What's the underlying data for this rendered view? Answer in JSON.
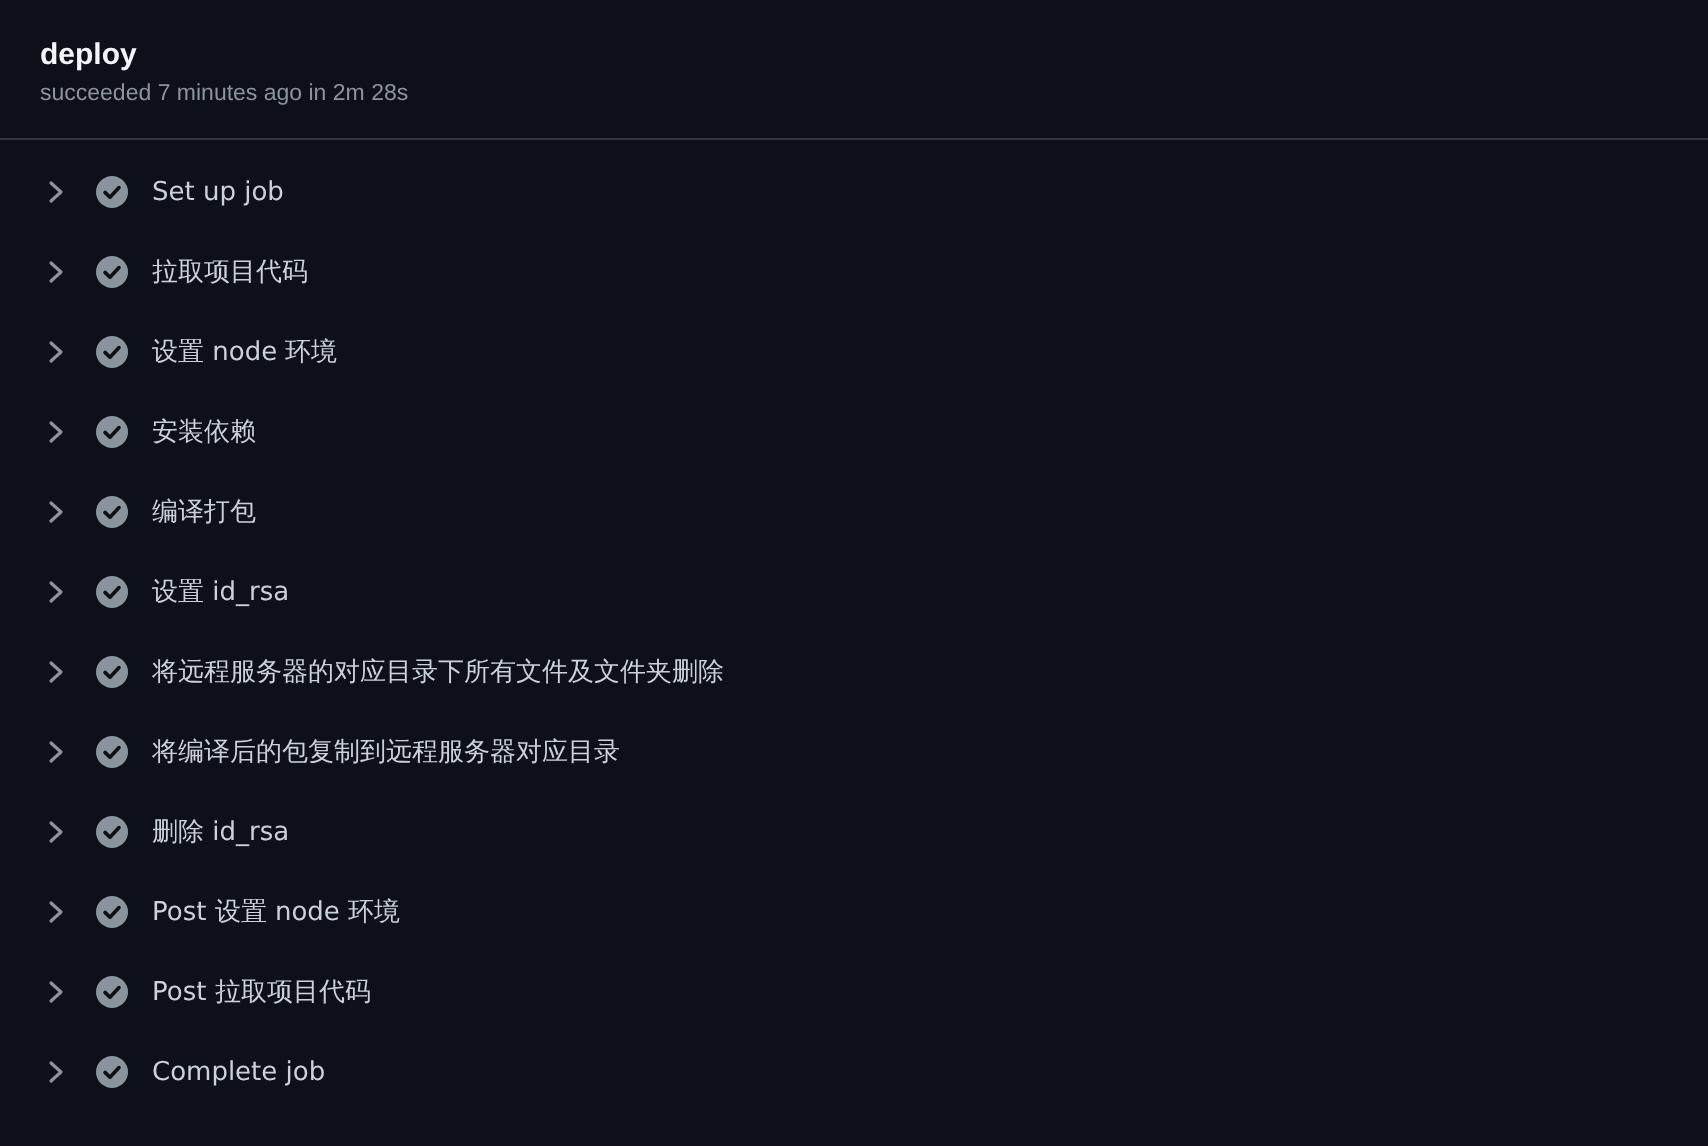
{
  "job": {
    "title": "deploy",
    "summary": "succeeded 7 minutes ago in 2m 28s"
  },
  "steps": [
    {
      "label": "Set up job",
      "kind": "success",
      "expanded": false
    },
    {
      "label": "拉取项目代码",
      "kind": "success",
      "expanded": false
    },
    {
      "label": "设置 node 环境",
      "kind": "success",
      "expanded": false
    },
    {
      "label": "安装依赖",
      "kind": "success",
      "expanded": false
    },
    {
      "label": "编译打包",
      "kind": "success",
      "expanded": false
    },
    {
      "label": "设置 id_rsa",
      "kind": "success",
      "expanded": false
    },
    {
      "label": "将远程服务器的对应目录下所有文件及文件夹删除",
      "kind": "success",
      "expanded": false
    },
    {
      "label": "将编译后的包复制到远程服务器对应目录",
      "kind": "success",
      "expanded": false
    },
    {
      "label": "删除 id_rsa",
      "kind": "success",
      "expanded": false
    },
    {
      "label": "Post 设置 node 环境",
      "kind": "success",
      "expanded": false
    },
    {
      "label": "Post 拉取项目代码",
      "kind": "success",
      "expanded": false
    },
    {
      "label": "Complete job",
      "kind": "success",
      "expanded": false
    }
  ]
}
